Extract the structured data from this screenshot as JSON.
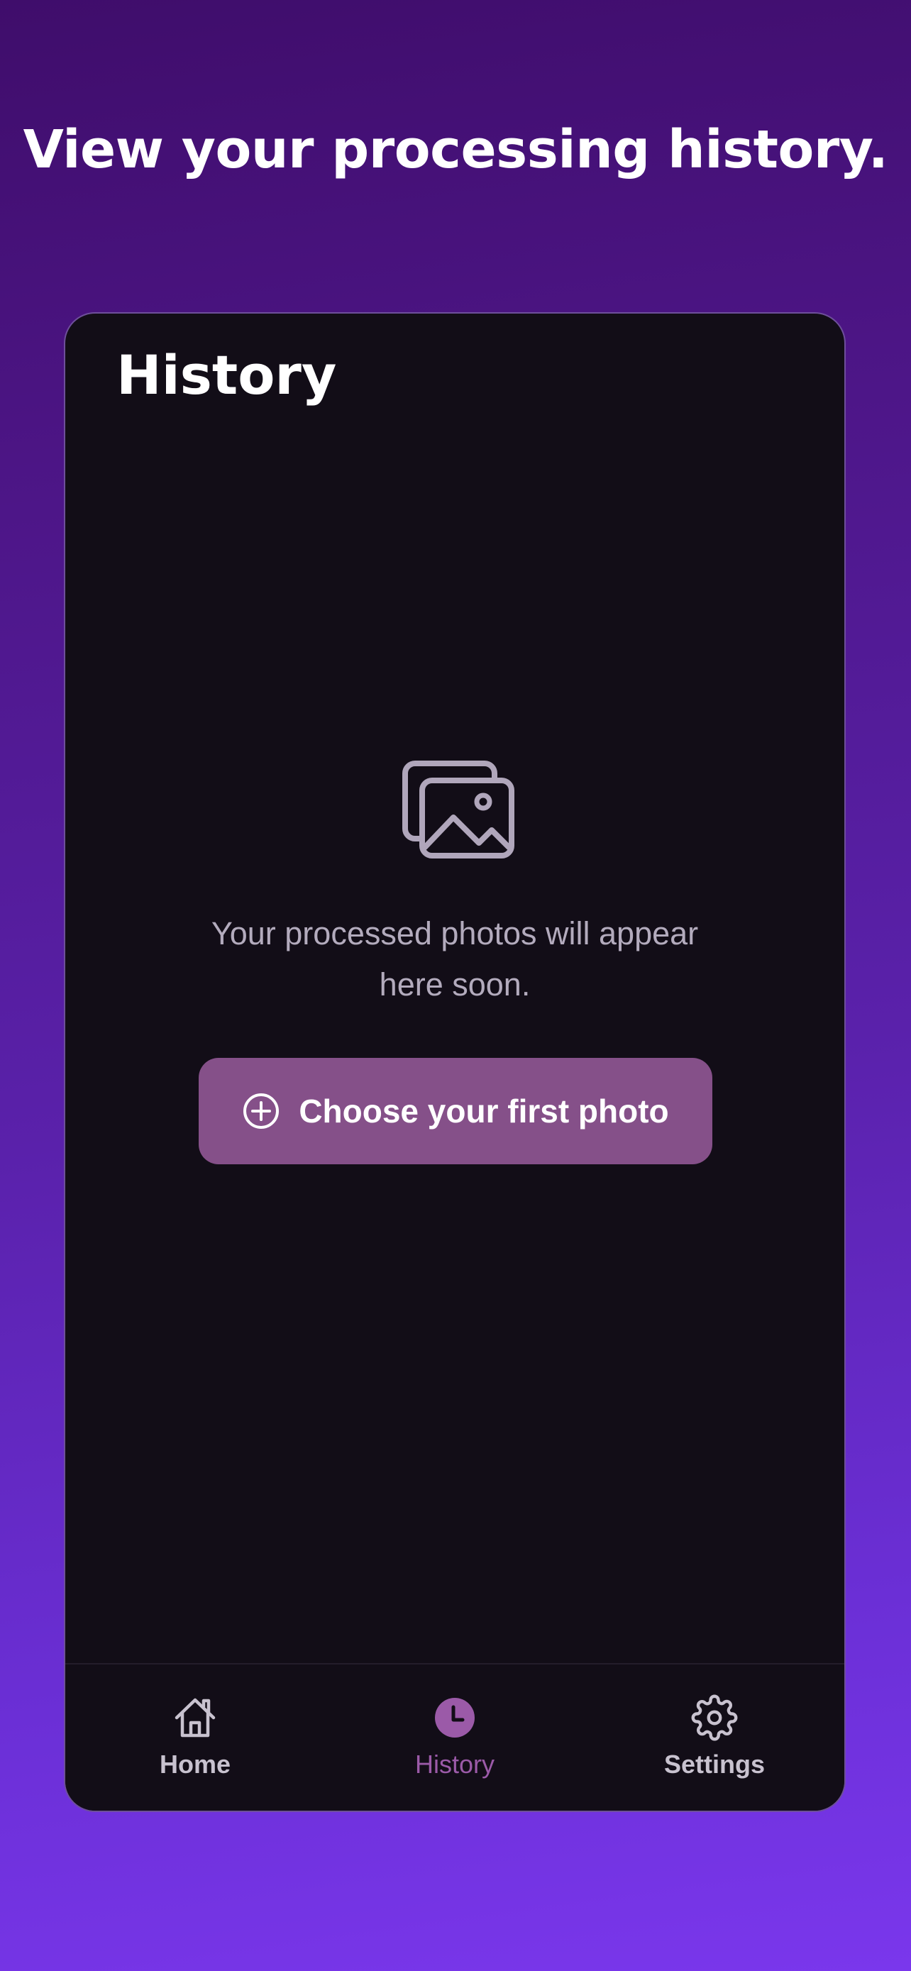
{
  "headline": "View your processing history.",
  "screen": {
    "title": "History",
    "empty_icon": "photo-gallery-icon",
    "empty_message": "Your processed photos will appear here soon.",
    "cta_label": "Choose your first photo",
    "cta_icon": "plus-circle-icon"
  },
  "tabs": [
    {
      "label": "Home",
      "icon": "home-icon",
      "active": false
    },
    {
      "label": "History",
      "icon": "clock-icon",
      "active": true
    },
    {
      "label": "Settings",
      "icon": "gear-icon",
      "active": false
    }
  ],
  "colors": {
    "background_top": "#3f0d6b",
    "background_bottom": "#7a37ec",
    "screen_background": "#120d17",
    "accent": "#855089",
    "active_tab": "#9b5aa8",
    "inactive_tab": "#c8c2cf"
  }
}
